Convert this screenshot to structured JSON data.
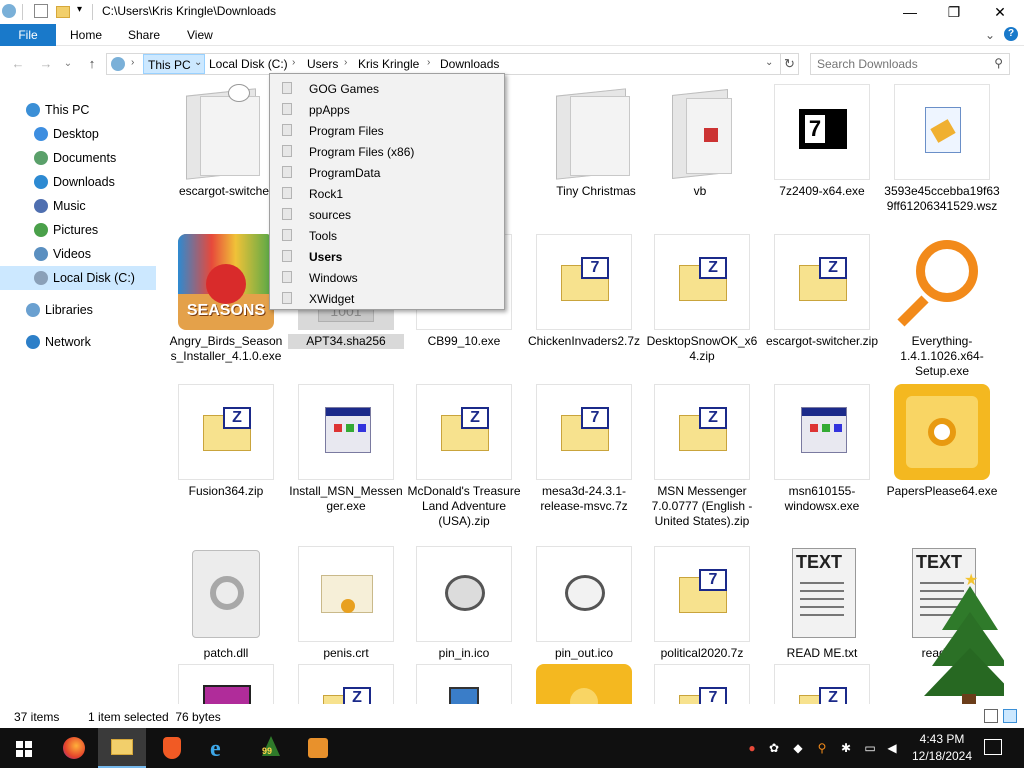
{
  "window": {
    "title": "C:\\Users\\Kris Kringle\\Downloads",
    "minimize": "—",
    "maximize": "❐",
    "close": "✕"
  },
  "ribbon": {
    "tabs": [
      "File",
      "Home",
      "Share",
      "View"
    ],
    "expand_icon": "⌄",
    "help_icon": "?"
  },
  "nav": {
    "back": "←",
    "forward": "→",
    "recent": "⌄",
    "up": "↑"
  },
  "address": {
    "crumbs": [
      "This PC",
      "Local Disk (C:)",
      "Users",
      "Kris Kringle",
      "Downloads"
    ],
    "dropdown_arrow": "⌄",
    "refresh": "↻"
  },
  "search": {
    "placeholder": "Search Downloads"
  },
  "sidebar": {
    "items": [
      {
        "label": "This PC",
        "color": "#3b8fd6"
      },
      {
        "label": "Desktop",
        "color": "#3d8ee0"
      },
      {
        "label": "Documents",
        "color": "#5aa06a"
      },
      {
        "label": "Downloads",
        "color": "#2d8ad2"
      },
      {
        "label": "Music",
        "color": "#4f6fb0"
      },
      {
        "label": "Pictures",
        "color": "#4aa04a"
      },
      {
        "label": "Videos",
        "color": "#5a8fc0"
      },
      {
        "label": "Local Disk (C:)",
        "color": "#8aa0b8"
      },
      {
        "label": "Libraries",
        "color": "#6aa0d0"
      },
      {
        "label": "Network",
        "color": "#2d7fc8"
      }
    ]
  },
  "dropdown": {
    "items": [
      "GOG Games",
      "ppApps",
      "Program Files",
      "Program Files (x86)",
      "ProgramData",
      "Rock1",
      "sources",
      "Tools",
      "Users",
      "Windows",
      "XWidget"
    ],
    "bold_item": "Users"
  },
  "files": [
    "escargot-switcher",
    "",
    "",
    "Tiny Christmas",
    "vb",
    "7z2409-x64.exe",
    "3593e45ccebba19f639ff61206341529.wsz",
    "Angry_Birds_Seasons_Installer_4.1.0.exe",
    "APT34.sha256",
    "CB99_10.exe",
    "ChickenInvaders2.7z",
    "DesktopSnowOK_x64.zip",
    "escargot-switcher.zip",
    "Everything-1.4.1.1026.x64-Setup.exe",
    "Fusion364.zip",
    "Install_MSN_Messenger.exe",
    "McDonald's Treasure Land Adventure (USA).zip",
    "mesa3d-24.3.1-release-msvc.7z",
    "MSN Messenger 7.0.0777 (English - United States).zip",
    "msn610155-windowsx.exe",
    "PapersPlease64.exe",
    "patch.dll",
    "penis.crt",
    "pin_in.ico",
    "pin_out.ico",
    "political2020.7z",
    "READ ME.txt",
    "readme"
  ],
  "thumb_text": {
    "seasons": "SEASONS",
    "text_a": "TEXT",
    "text_b": "TEXT",
    "z": "Z",
    "seven": "7",
    "sha": "1001"
  },
  "status": {
    "count": "37 items",
    "selection": "1 item selected  76 bytes"
  },
  "taskbar": {
    "time": "4:43 PM",
    "date": "12/18/2024",
    "badge": "99"
  },
  "colors": {
    "accent": "#1979ca",
    "selected": "#cce8ff",
    "taskbar": "#101010"
  }
}
